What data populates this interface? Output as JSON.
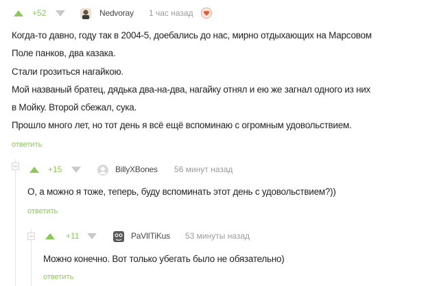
{
  "comments": [
    {
      "rating": "+52",
      "username": "Nedvoray",
      "time": "1 час назад",
      "lines": [
        "Когда-то давно, году так в 2004-5, доебались до нас, мирно отдыхающих на Марсовом",
        "Поле панков, два казака.",
        "Стали грозиться нагайкою.",
        "Мой названый братец, дядька два-на-два, нагайку отнял и ею же загнал одного из них",
        "в Мойку. Второй сбежал, сука.",
        "Прошло много лет, но тот день я всё ещё вспоминаю с огромным удовольствием."
      ],
      "reply": "ответить",
      "icons": {
        "upvote": "upvote-arrow-icon",
        "downvote": "downvote-arrow-icon",
        "avatar": "user-avatar",
        "badge": "heart-badge-icon"
      }
    },
    {
      "rating": "+15",
      "username": "BillyXBones",
      "time": "56 минут назад",
      "lines": [
        "О, а можно я тоже, теперь, буду вспоминать этот день с удовольствием?))"
      ],
      "reply": "ответить",
      "icons": {
        "upvote": "upvote-arrow-icon",
        "downvote": "downvote-arrow-icon",
        "avatar": "default-avatar-icon"
      }
    },
    {
      "rating": "+11",
      "username": "PaVlITiKus",
      "time": "53 минуты назад",
      "lines": [
        "Можно конечно. Вот только убегать было не обязательно)"
      ],
      "reply": "ответить",
      "icons": {
        "upvote": "upvote-arrow-icon",
        "downvote": "downvote-arrow-icon",
        "avatar": "user-avatar"
      }
    }
  ],
  "colors": {
    "accent": "#8ac858",
    "downvote": "#c9c9c9",
    "text": "#222222",
    "muted": "#9a9a9a"
  }
}
